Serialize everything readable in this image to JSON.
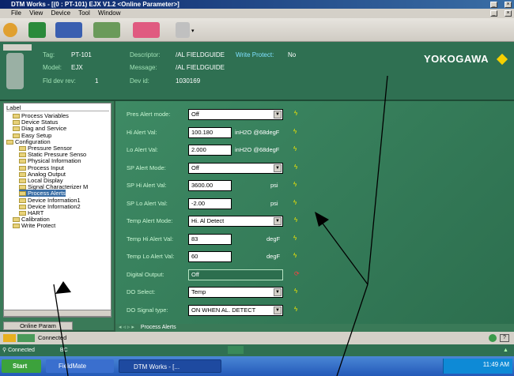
{
  "window": {
    "title": "DTM Works - [(0 : PT-101) EJX V1.2 <Online Parameter>]",
    "controls": [
      "_",
      "×"
    ]
  },
  "menu": {
    "items": [
      "File",
      "View",
      "Device",
      "Tool",
      "Window"
    ]
  },
  "header": {
    "tag_label": "Tag:",
    "tag": "PT-101",
    "model_label": "Model:",
    "model": "EJX",
    "fld_label": "Fld dev rev:",
    "fld": "1",
    "descriptor_label": "Descriptor:",
    "descriptor": "/AL FIELDGUIDE",
    "write_protect_label": "Write Protect:",
    "write_protect": "No",
    "message_label": "Message:",
    "message": "/AL FIELDGUIDE",
    "devid_label": "Dev id:",
    "devid": "1030169",
    "brand": "YOKOGAWA"
  },
  "tree": {
    "header": "Label",
    "items": [
      {
        "label": "Process Variables",
        "level": 1
      },
      {
        "label": "Device Status",
        "level": 1
      },
      {
        "label": "Diag and Service",
        "level": 1
      },
      {
        "label": "Easy Setup",
        "level": 1
      },
      {
        "label": "Configuration",
        "level": 0
      },
      {
        "label": "Pressure Sensor",
        "level": 2
      },
      {
        "label": "Static Pressure Senso",
        "level": 2
      },
      {
        "label": "Physical Information",
        "level": 2
      },
      {
        "label": "Process Input",
        "level": 2
      },
      {
        "label": "Analog Output",
        "level": 2
      },
      {
        "label": "Local Display",
        "level": 2
      },
      {
        "label": "Signal Characterizer M",
        "level": 2
      },
      {
        "label": "Process Alerts",
        "level": 2,
        "selected": true
      },
      {
        "label": "Device Information1",
        "level": 2
      },
      {
        "label": "Device Information2",
        "level": 2
      },
      {
        "label": "HART",
        "level": 2
      },
      {
        "label": "Calibration",
        "level": 1
      },
      {
        "label": "Write Protect",
        "level": 1
      }
    ],
    "tab": "Online Param"
  },
  "form": {
    "fields": [
      {
        "label": "Pres Alert mode:",
        "value": "Off",
        "kind": "dropdown",
        "unit": ""
      },
      {
        "label": "Hi Alert Val:",
        "value": "100.180",
        "kind": "text",
        "unit": "inH2O @68degF"
      },
      {
        "label": "Lo Alert Val:",
        "value": "2.000",
        "kind": "text",
        "unit": "inH2O @68degF"
      },
      {
        "label": "SP Alert Mode:",
        "value": "Off",
        "kind": "dropdown",
        "unit": ""
      },
      {
        "label": "SP Hi Alert Val:",
        "value": "3600.00",
        "kind": "text",
        "unit": "psi"
      },
      {
        "label": "SP Lo Alert Val:",
        "value": "-2.00",
        "kind": "text",
        "unit": "psi"
      },
      {
        "label": "Temp Alert Mode:",
        "value": "Hi. Al Detect",
        "kind": "dropdown",
        "unit": ""
      },
      {
        "label": "Temp Hi Alert Val:",
        "value": "83",
        "kind": "text",
        "unit": "degF"
      },
      {
        "label": "Temp Lo Alert Val:",
        "value": "60",
        "kind": "text",
        "unit": "degF"
      },
      {
        "label": "Digital Output:",
        "value": "Off",
        "kind": "readonly",
        "unit": ""
      },
      {
        "label": "DO Select:",
        "value": "Temp",
        "kind": "dropdown",
        "unit": ""
      },
      {
        "label": "DO Signal type:",
        "value": "ON WHEN AL. DETECT",
        "kind": "dropdown",
        "unit": ""
      }
    ]
  },
  "bottombar": {
    "text": "Process Alerts"
  },
  "statusbar": {
    "connected": "Connected",
    "conn2": "Connected",
    "bc": "BC"
  },
  "taskbar": {
    "start": "Start",
    "task1": "FieldMate",
    "task2": "DTM Works - [...",
    "clock": "11:49 AM"
  },
  "colors": {
    "panel": "#2f7052",
    "accent": "#f5e700",
    "label": "#c8f5d2"
  }
}
